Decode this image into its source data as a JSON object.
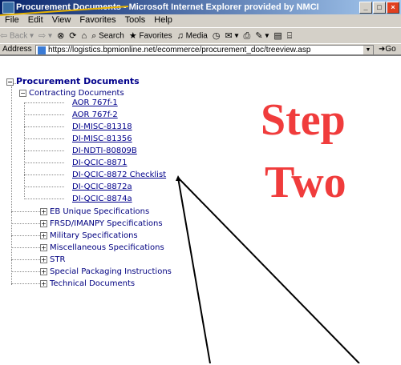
{
  "window": {
    "title": "Procurement Documents - Microsoft Internet Explorer provided by NMCI"
  },
  "menubar": {
    "items": [
      "File",
      "Edit",
      "View",
      "Favorites",
      "Tools",
      "Help"
    ]
  },
  "toolbar": {
    "back_label": "Back",
    "search_label": "Search",
    "favorites_label": "Favorites",
    "media_label": "Media"
  },
  "address_bar": {
    "label": "Address",
    "url": "https://logistics.bpmionline.net/ecommerce/procurement_doc/treeview.asp",
    "go_label": "Go"
  },
  "tree": {
    "root": "Procurement Documents",
    "contracting": {
      "label": "Contracting Documents",
      "items": [
        "AOR 767f-1",
        "AOR 767f-2",
        "DI-MISC-81318",
        "DI-MISC-81356",
        "DI-NDTI-80809B",
        "DI-QCIC-8871",
        "DI-QCIC-8872 Checklist",
        "DI-QCIC-8872a",
        "DI-QCIC-8874a"
      ]
    },
    "categories": [
      "EB Unique Specifications",
      "FRSD/IMANPY Specifications",
      "Military Specifications",
      "Miscellaneous Specifications",
      "STR",
      "Special Packaging Instructions",
      "Technical Documents"
    ]
  },
  "annotation": {
    "line1": "Step",
    "line2": "Two",
    "color": "#f03c3c"
  }
}
